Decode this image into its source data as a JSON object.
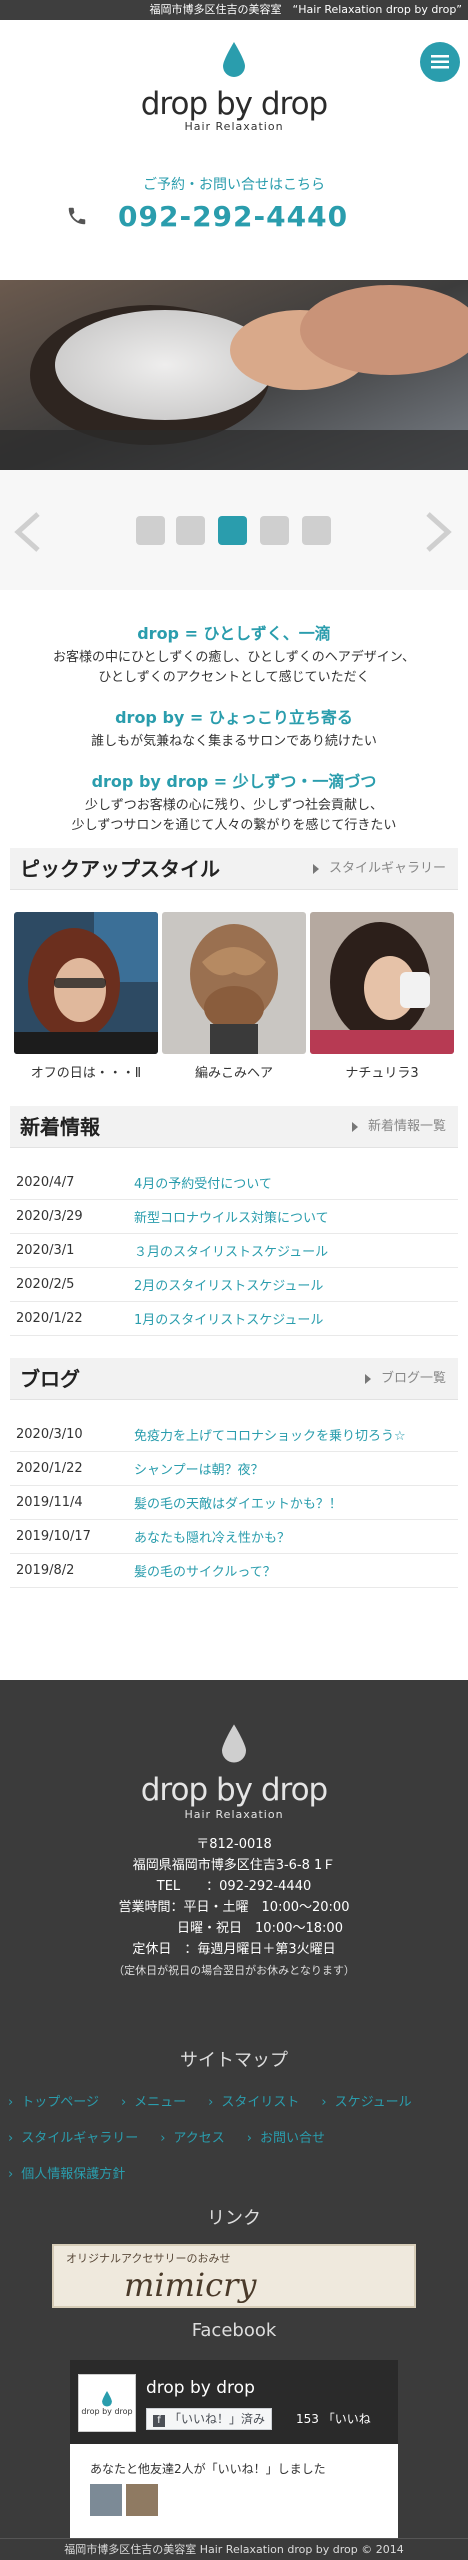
{
  "topbar": {
    "text": "福岡市博多区住吉の美容室　“Hair Relaxation drop by drop”"
  },
  "header": {
    "logo_text": "drop by drop",
    "logo_sub": "Hair Relaxation",
    "contact_label": "ご予約・お問い合せはこちら",
    "phone": "092-292-4440",
    "menu_icon": "hamburger-icon"
  },
  "carousel": {
    "active_index": 3,
    "slides": 5,
    "prev_icon": "chevron-left-icon",
    "next_icon": "chevron-right-icon"
  },
  "concept": [
    {
      "title": "drop = ひとしずく、一滴",
      "desc": [
        "お客様の中にひとしずくの癒し、ひとしずくのヘアデザイン、",
        "ひとしずくのアクセントとして感じていただく"
      ]
    },
    {
      "title": "drop by = ひょっこり立ち寄る",
      "desc": [
        "誰しもが気兼ねなく集まるサロンであり続けたい"
      ]
    },
    {
      "title": "drop by drop = 少しずつ・一滴づつ",
      "desc": [
        "少しずつお客様の心に残り、少しずつ社会貢献し、",
        "少しずつサロンを通じて人々の繋がりを感じて行きたい"
      ]
    }
  ],
  "pickup": {
    "title": "ピックアップスタイル",
    "link": "スタイルギャラリー",
    "items": [
      {
        "caption": "オフの日は・・・Ⅱ"
      },
      {
        "caption": "編みこみヘア"
      },
      {
        "caption": "ナチュリラ3"
      }
    ]
  },
  "news": {
    "title": "新着情報",
    "link": "新着情報一覧",
    "items": [
      {
        "date": "2020/4/7",
        "title": "4月の予約受付について"
      },
      {
        "date": "2020/3/29",
        "title": "新型コロナウイルス対策について"
      },
      {
        "date": "2020/3/1",
        "title": "３月のスタイリストスケジュール"
      },
      {
        "date": "2020/2/5",
        "title": "2月のスタイリストスケジュール"
      },
      {
        "date": "2020/1/22",
        "title": "1月のスタイリストスケジュール"
      }
    ]
  },
  "blog": {
    "title": "ブログ",
    "link": "ブログ一覧",
    "items": [
      {
        "date": "2020/3/10",
        "title": "免疫力を上げてコロナショックを乗り切ろう☆"
      },
      {
        "date": "2020/1/22",
        "title": "シャンプーは朝？夜？"
      },
      {
        "date": "2019/11/4",
        "title": "髪の毛の天敵はダイエットかも？！"
      },
      {
        "date": "2019/10/17",
        "title": "あなたも隠れ冷え性かも？"
      },
      {
        "date": "2019/8/2",
        "title": "髪の毛のサイクルって？"
      }
    ]
  },
  "footer": {
    "logo_text": "drop by drop",
    "logo_sub": "Hair Relaxation",
    "address_lines": [
      "〒812-0018",
      "福岡県福岡市博多区住吉3-6-8 1Ｆ",
      "TEL　　：092-292-4440",
      "営業時間：平日・土曜　10:00～20:00",
      "　　　　日曜・祝日　10:00～18:00",
      "定休日　：毎週月曜日＋第3火曜日"
    ],
    "address_note": "（定休日が祝日の場合翌日がお休みとなります）",
    "sitemap_title": "サイトマップ",
    "sitemap_rows": [
      [
        "トップページ",
        "メニュー",
        "スタイリスト",
        "スケジュール"
      ],
      [
        "スタイルギャラリー",
        "アクセス",
        "お問い合せ"
      ],
      [
        "個人情報保護方針"
      ]
    ],
    "links_title": "リンク",
    "banner_sub": "オリジナルアクセサリーのおみせ",
    "banner_main": "mimicry",
    "facebook_title": "Facebook",
    "fb_page_name": "drop by drop",
    "fb_like_btn": "「いいね！」済み",
    "fb_like_count": "153 「いいね",
    "fb_friends_text": "あなたと他友達2人が「いいね！」しました",
    "copyright": "福岡市博多区住吉の美容室 Hair Relaxation drop by drop © 2014"
  },
  "colors": {
    "accent": "#2a9dad",
    "footer_bg": "#3b3b3b",
    "topbar_bg": "#3e3e3e"
  }
}
